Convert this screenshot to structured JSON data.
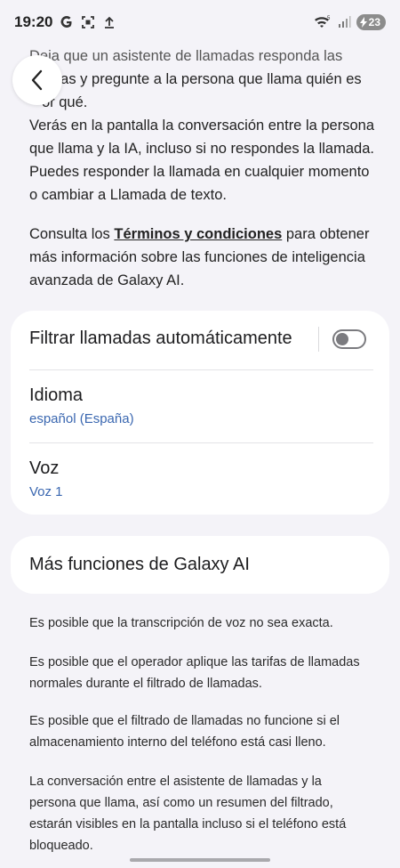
{
  "status_bar": {
    "time": "19:20",
    "battery": "23"
  },
  "intro": {
    "line1": "Deja que un asistente de llamadas responda las",
    "line2_rest": "das y pregunte a la persona que llama quién es",
    "line3_rest": "or qué.",
    "paragraph2": "Verás en la pantalla la conversación entre la persona que llama y la IA, incluso si no respondes la llamada. Puedes responder la llamada en cualquier momento o cambiar a Llamada de texto."
  },
  "terms": {
    "prefix": "Consulta los ",
    "link": "Términos y condiciones",
    "suffix": " para obtener más información sobre las funciones de inteligencia avanzada de Galaxy AI."
  },
  "settings": {
    "filter_label": "Filtrar llamadas automáticamente",
    "filter_enabled": false,
    "language_label": "Idioma",
    "language_value": "español (España)",
    "voice_label": "Voz",
    "voice_value": "Voz 1"
  },
  "more": {
    "label": "Más funciones de Galaxy AI"
  },
  "notes": [
    "Es posible que la transcripción de voz no sea exacta.",
    "Es posible que el operador aplique las tarifas de llamadas normales durante el filtrado de llamadas.",
    "Es posible que el filtrado de llamadas no funcione si el almacenamiento interno del teléfono está casi lleno.",
    "La conversación entre el asistente de llamadas y la persona que llama, así como un resumen del filtrado, estarán visibles en la pantalla incluso si el teléfono está bloqueado."
  ]
}
